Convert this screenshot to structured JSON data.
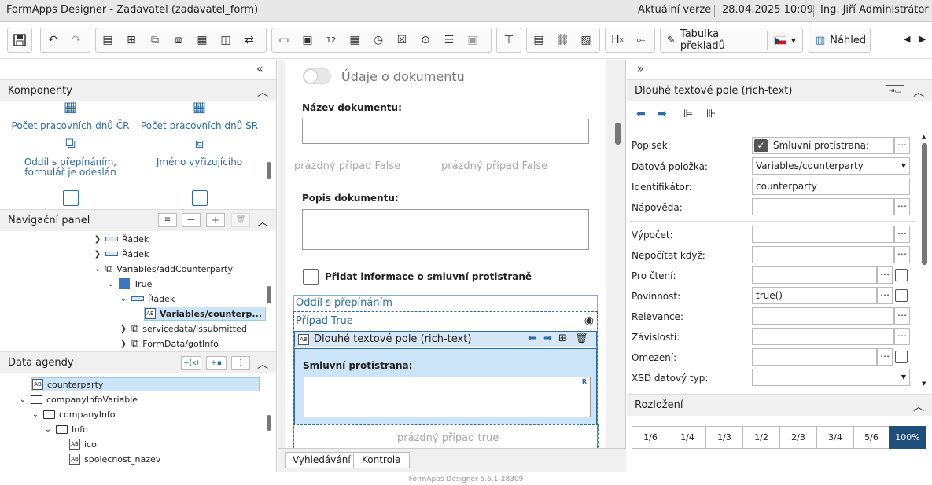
{
  "titlebar": {
    "title": "FormApps Designer - Zadavatel (zadavatel_form)",
    "version": "Aktuální verze",
    "datetime": "28.04.2025 10:09",
    "user": "Ing. Jiří Administrátor"
  },
  "toolbar": {
    "translations_label": "Tabulka překladů",
    "preview_label": "Náhled",
    "language_flag": "CZ",
    "hx_label": "H"
  },
  "left": {
    "components": {
      "title": "Komponenty",
      "items": [
        {
          "label": "Počet pracovních dnů ČR",
          "icon": "calendar-cz-icon"
        },
        {
          "label": "Počet pracovních dnů SR",
          "icon": "calendar-sk-icon"
        },
        {
          "label": "Oddíl s přepínáním, formulář je odeslán",
          "icon": "section-switch-icon"
        },
        {
          "label": "Jméno vyřizujícího",
          "icon": "person-icon"
        }
      ]
    },
    "nav": {
      "title": "Navigační panel",
      "items": [
        {
          "label": "Řádek",
          "indent": 0
        },
        {
          "label": "Řádek",
          "indent": 0
        },
        {
          "label": "Variables/addCounterparty",
          "indent": 0
        },
        {
          "label": "True",
          "indent": 1
        },
        {
          "label": "Řádek",
          "indent": 2
        },
        {
          "label": "Variables/counterp...",
          "indent": 3
        },
        {
          "label": "servicedata/issubmitted",
          "indent": 1
        },
        {
          "label": "FormData/gotInfo",
          "indent": 1
        }
      ]
    },
    "data": {
      "title": "Data agendy",
      "items": [
        {
          "label": "counterparty"
        },
        {
          "label": "companyInfoVariable"
        },
        {
          "label": "companyInfo"
        },
        {
          "label": "Info"
        },
        {
          "label": "ico"
        },
        {
          "label": "spolecnost_nazev"
        }
      ]
    }
  },
  "canvas": {
    "toggle_label": "Údaje o dokumentu",
    "doc_name_label": "Název dokumentu:",
    "empty_false_1": "prázdný případ False",
    "empty_false_2": "prázdný případ False",
    "doc_desc_label": "Popis dokumentu:",
    "checkbox_label": "Přidat informace o smluvní protistraně",
    "section_label": "Oddíl s přepínáním",
    "case_true_label": "Případ True",
    "rich_text_label": "Dlouhé textové pole (rich-text)",
    "counterparty_label": "Smluvní protistrana:",
    "rich_marker": "R",
    "empty_true": "prázdný případ true",
    "tabs": [
      "Vyhledávání",
      "Kontrola"
    ]
  },
  "props": {
    "title": "Dlouhé textové pole (rich-text)",
    "rows": [
      {
        "label": "Popisek:",
        "value": "Smluvní protistrana:"
      },
      {
        "label": "Datová položka:",
        "value": "Variables/counterparty"
      },
      {
        "label": "Identifikátor:",
        "value": "counterparty"
      },
      {
        "label": "Nápověda:",
        "value": ""
      },
      {
        "label": "Výpočet:",
        "value": ""
      },
      {
        "label": "Nepočítat když:",
        "value": ""
      },
      {
        "label": "Pro čtení:",
        "value": ""
      },
      {
        "label": "Povinnost:",
        "value": "true()"
      },
      {
        "label": "Relevance:",
        "value": ""
      },
      {
        "label": "Závislosti:",
        "value": ""
      },
      {
        "label": "Omezení:",
        "value": ""
      },
      {
        "label": "XSD datový typ:",
        "value": ""
      }
    ],
    "layout_title": "Rozložení",
    "ratios": [
      "1/6",
      "1/4",
      "1/3",
      "1/2",
      "2/3",
      "3/4",
      "5/6",
      "100%"
    ]
  },
  "footer": {
    "version": "FormApps Designer 5.6.1-28309"
  },
  "colors": {
    "accent": "#2e6da4",
    "selected": "#1f4e7a",
    "highlight": "#cce4f7"
  }
}
